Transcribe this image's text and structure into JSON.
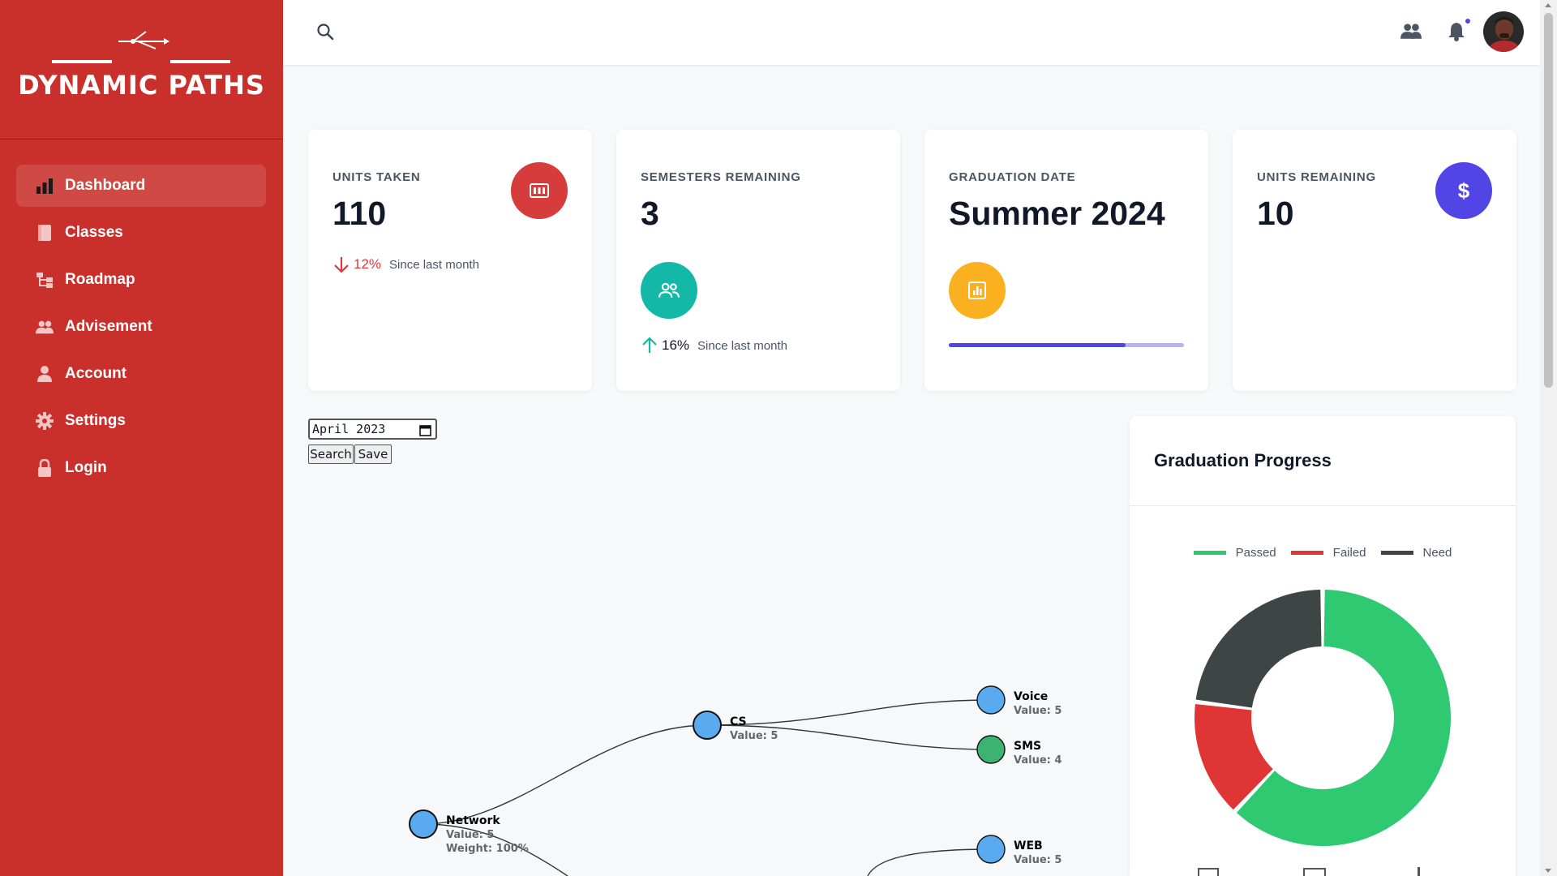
{
  "brand": {
    "name": "DYNAMIC PATHS",
    "color": "#c9302c"
  },
  "sidebar": {
    "items": [
      {
        "label": "Dashboard",
        "icon": "bar-chart-icon",
        "active": true
      },
      {
        "label": "Classes",
        "icon": "book-icon",
        "active": false
      },
      {
        "label": "Roadmap",
        "icon": "roadmap-icon",
        "active": false
      },
      {
        "label": "Advisement",
        "icon": "users-icon",
        "active": false
      },
      {
        "label": "Account",
        "icon": "user-icon",
        "active": false
      },
      {
        "label": "Settings",
        "icon": "gear-icon",
        "active": false
      },
      {
        "label": "Login",
        "icon": "lock-icon",
        "active": false
      }
    ]
  },
  "topbar": {
    "icons": [
      "search-icon",
      "users-icon",
      "bell-icon",
      "avatar"
    ]
  },
  "cards": [
    {
      "label": "UNITS TAKEN",
      "value": "110",
      "trend": {
        "direction": "down",
        "percent": "12%",
        "since": "Since last month",
        "color": "#d63c3c"
      },
      "badge": {
        "icon": "receipt-icon",
        "color": "#d63c3c"
      }
    },
    {
      "label": "SEMESTERS REMAINING",
      "value": "3",
      "trend": {
        "direction": "up",
        "percent": "16%",
        "since": "Since last month",
        "color": "#14b8a6"
      },
      "badge": {
        "icon": "users-icon",
        "color": "#14b8a6"
      }
    },
    {
      "label": "GRADUATION DATE",
      "value": "Summer 2024",
      "progress": 0.75,
      "badge": {
        "icon": "chart-icon",
        "color": "#fbb020"
      }
    },
    {
      "label": "UNITS REMAINING",
      "value": "10",
      "badge": {
        "icon": "dollar-icon",
        "color": "#5145e5"
      }
    }
  ],
  "date_form": {
    "value": "April 2023",
    "search_label": "Search",
    "save_label": "Save"
  },
  "tree": {
    "nodes": [
      {
        "name": "Network",
        "value_text": "Value: 5",
        "weight_text": "Weight: 100%",
        "color": "#5aaaf0"
      },
      {
        "name": "CS",
        "value_text": "Value: 5",
        "color": "#5aaaf0"
      },
      {
        "name": "Voice",
        "value_text": "Value: 5",
        "color": "#5aaaf0"
      },
      {
        "name": "SMS",
        "value_text": "Value: 4",
        "color": "#3cb371"
      },
      {
        "name": "WEB",
        "value_text": "Value: 5",
        "color": "#5aaaf0"
      }
    ]
  },
  "graduation": {
    "title": "Graduation Progress",
    "chart_data": {
      "type": "pie",
      "title": "Graduation Progress",
      "categories": [
        "Passed",
        "Failed",
        "Need"
      ],
      "values": [
        62,
        15,
        23
      ],
      "colors": [
        "#2ec971",
        "#e03535",
        "#3e4645"
      ],
      "legend": "top"
    }
  }
}
